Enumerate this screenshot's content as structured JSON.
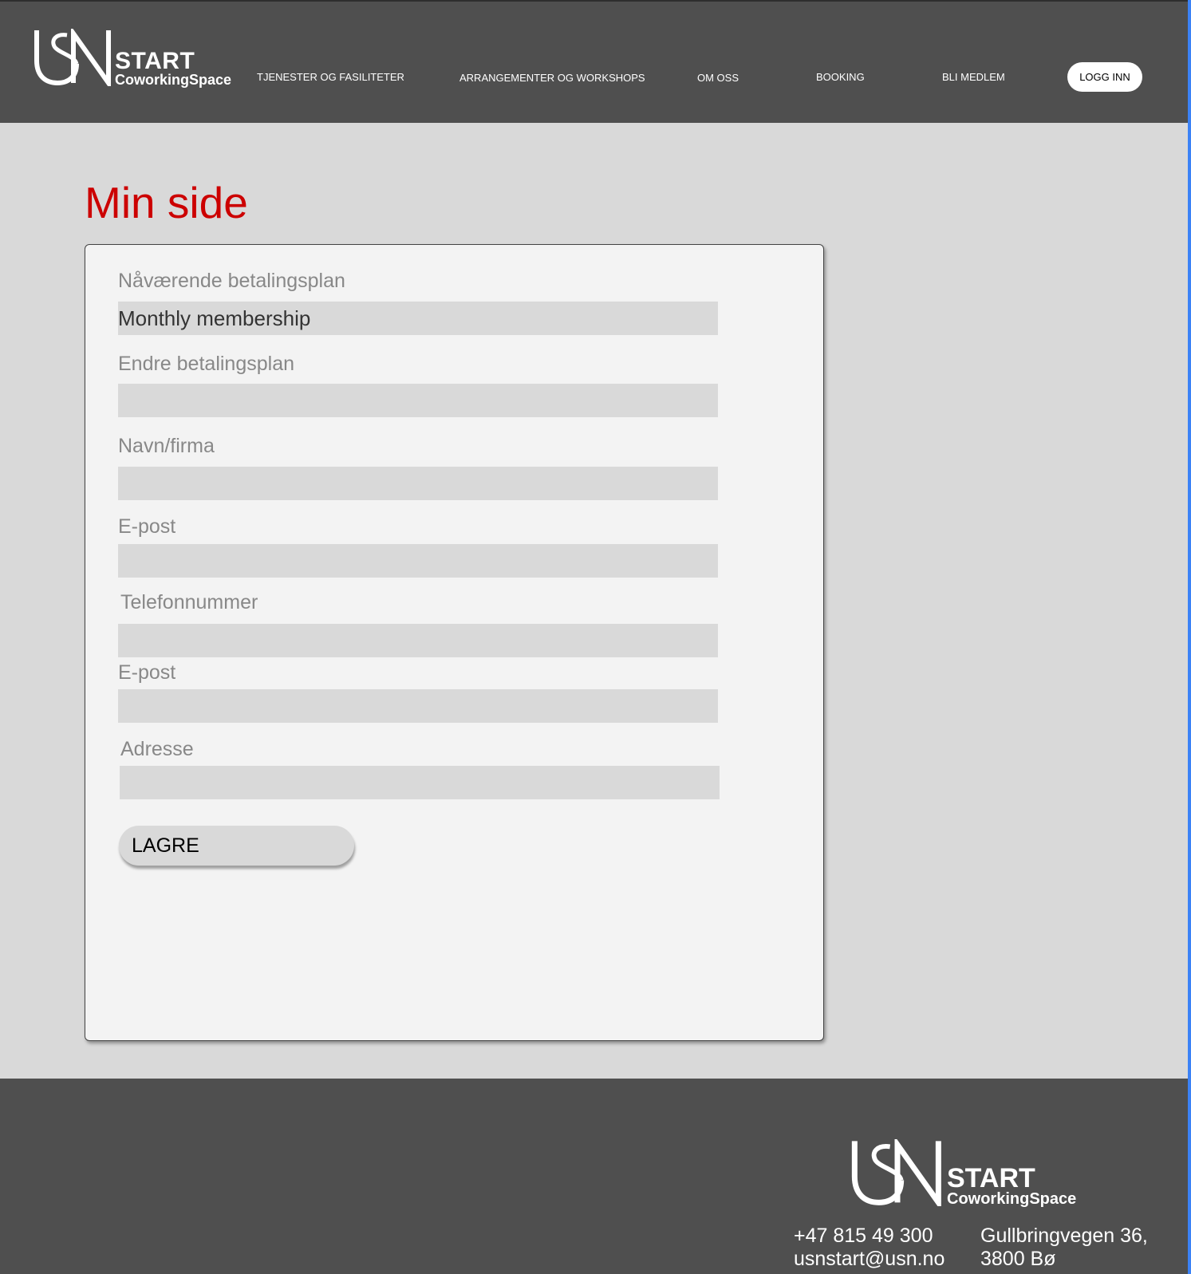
{
  "brand": {
    "logo_mark": "USN",
    "logo_word": "START",
    "logo_sub": "CoworkingSpace"
  },
  "nav": {
    "items": [
      {
        "label": "TJENESTER OG FASILITETER"
      },
      {
        "label": "ARRANGEMENTER OG WORKSHOPS"
      },
      {
        "label": "OM OSS"
      },
      {
        "label": "BOOKING"
      },
      {
        "label": "BLI MEDLEM"
      }
    ],
    "login_label": "LOGG INN"
  },
  "page": {
    "title": "Min side"
  },
  "form": {
    "fields": [
      {
        "label": "Nåværende betalingsplan",
        "value": "Monthly membership"
      },
      {
        "label": "Endre betalingsplan",
        "value": ""
      },
      {
        "label": "Navn/firma",
        "value": ""
      },
      {
        "label": "E-post",
        "value": ""
      },
      {
        "label": "Telefonnummer",
        "value": ""
      },
      {
        "label": "E-post",
        "value": ""
      },
      {
        "label": "Adresse",
        "value": ""
      }
    ],
    "save_label": "LAGRE"
  },
  "footer": {
    "phone": "+47 815 49 300",
    "email": "usnstart@usn.no",
    "address_line1": "Gullbringvegen 36,",
    "address_line2": "3800 Bø"
  },
  "colors": {
    "header_bg": "#4f4f4f",
    "page_bg": "#d9d9d9",
    "title_red": "#cc0000",
    "card_bg": "#f3f3f3",
    "input_bg": "#d9d9d9"
  }
}
